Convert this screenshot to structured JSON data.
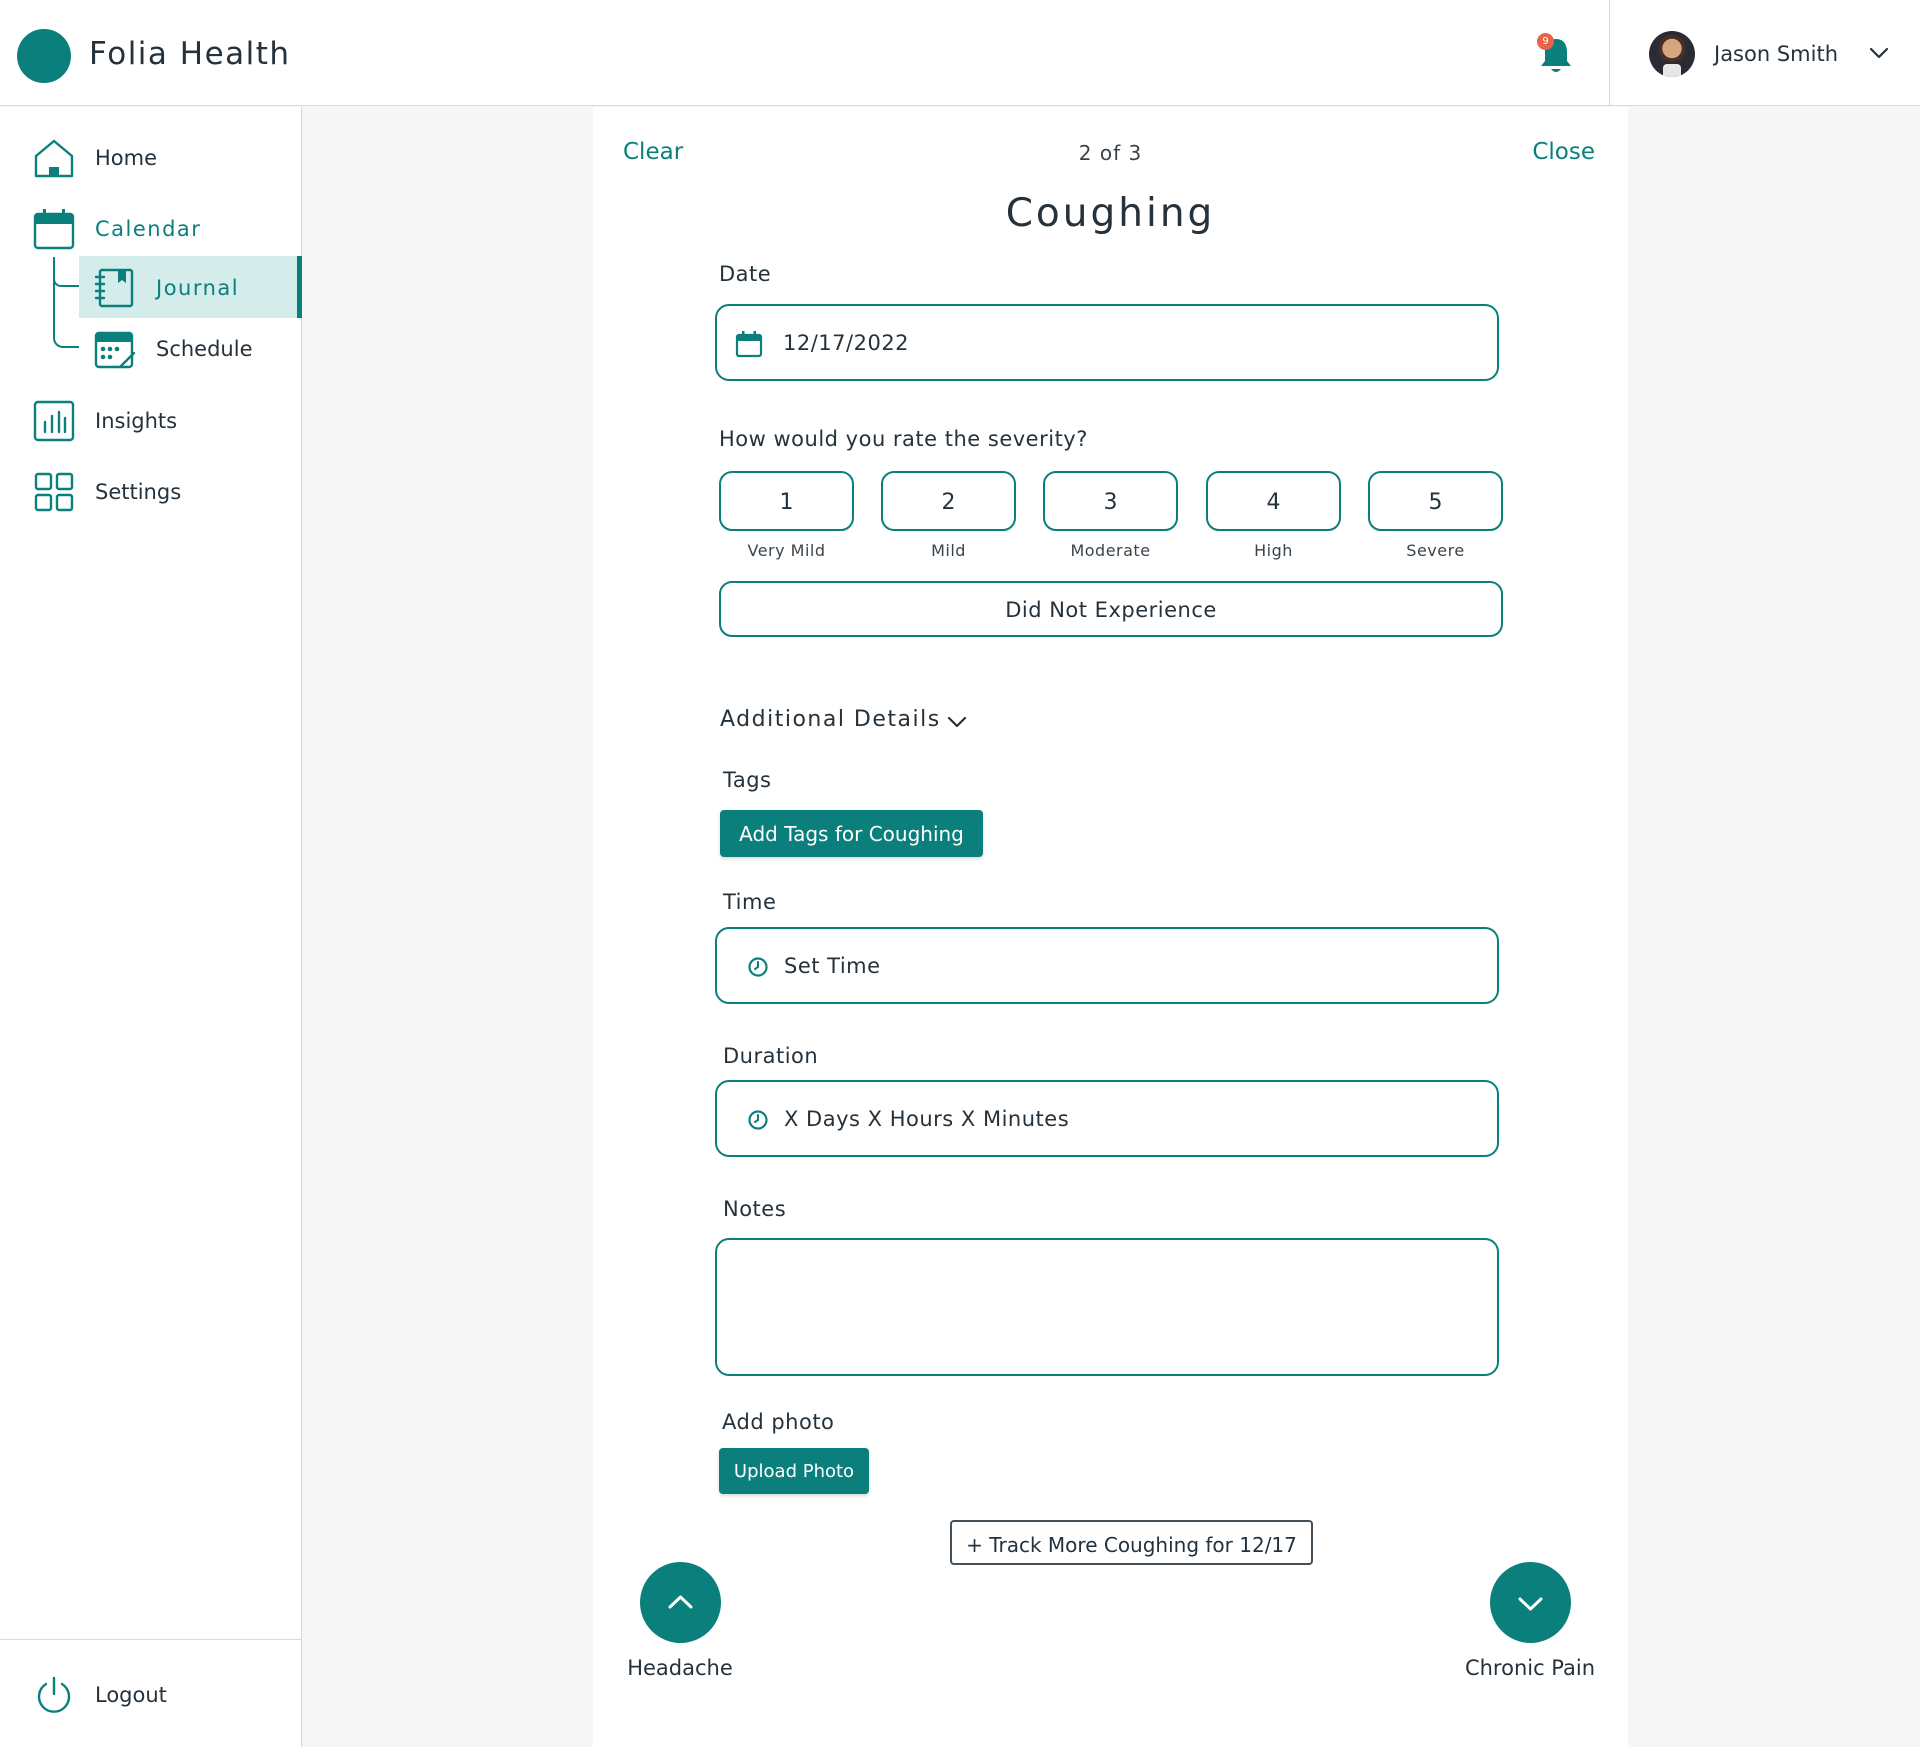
{
  "app": {
    "name": "Folia Health"
  },
  "header": {
    "notification_count": "9",
    "user_name": "Jason Smith"
  },
  "sidebar": {
    "items": [
      {
        "label": "Home",
        "icon": "home-icon"
      },
      {
        "label": "Calendar",
        "icon": "calendar-icon",
        "active": true
      },
      {
        "label": "Insights",
        "icon": "bar-chart-icon"
      },
      {
        "label": "Settings",
        "icon": "grid-icon"
      }
    ],
    "sub_items": [
      {
        "label": "Journal",
        "icon": "journal-icon",
        "selected": true
      },
      {
        "label": "Schedule",
        "icon": "schedule-icon"
      }
    ],
    "logout_label": "Logout"
  },
  "form": {
    "clear_label": "Clear",
    "close_label": "Close",
    "step": "2 of 3",
    "title": "Coughing",
    "date_label": "Date",
    "date_value": "12/17/2022",
    "severity_question": "How would you rate the severity?",
    "severity_options": [
      {
        "value": "1",
        "label": "Very Mild"
      },
      {
        "value": "2",
        "label": "Mild"
      },
      {
        "value": "3",
        "label": "Moderate"
      },
      {
        "value": "4",
        "label": "High"
      },
      {
        "value": "5",
        "label": "Severe"
      }
    ],
    "did_not_experience_label": "Did Not Experience",
    "additional_details_label": "Additional Details",
    "tags_label": "Tags",
    "add_tags_button": "Add Tags for Coughing",
    "time_label": "Time",
    "time_placeholder": "Set Time",
    "duration_label": "Duration",
    "duration_placeholder": "X Days X Hours X Minutes",
    "notes_label": "Notes",
    "notes_value": "",
    "add_photo_label": "Add photo",
    "upload_photo_button": "Upload Photo",
    "track_more_button": "+ Track More Coughing for 12/17",
    "previous_symptom": "Headache",
    "next_symptom": "Chronic Pain"
  },
  "colors": {
    "accent": "#0a7f7c",
    "accent_light": "#d4ecea",
    "badge": "#e8634a"
  }
}
